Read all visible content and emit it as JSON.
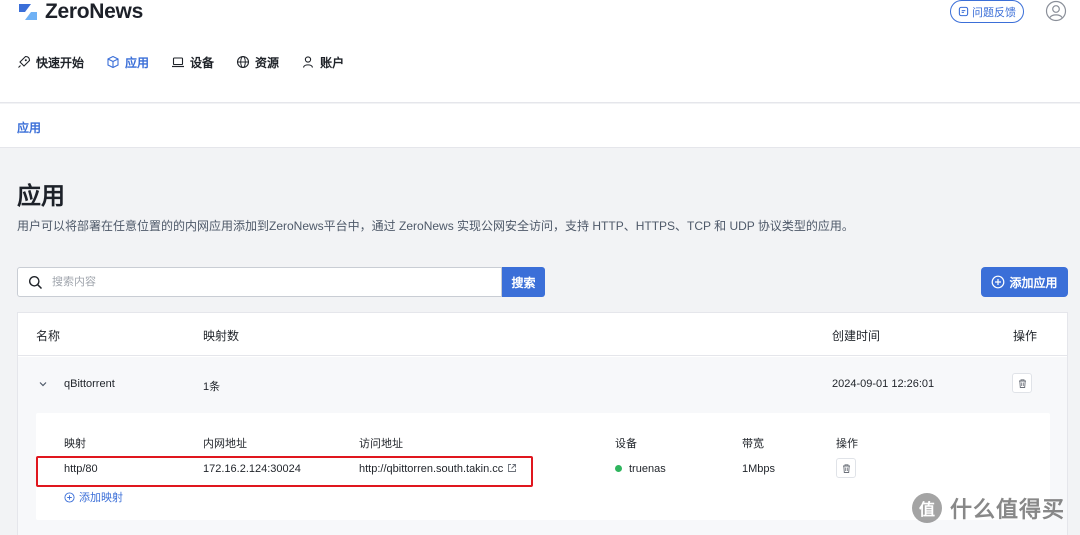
{
  "brand": {
    "name": "ZeroNews",
    "accent": "#3b6fd8"
  },
  "header": {
    "feedback_label": "问题反馈"
  },
  "nav": {
    "items": [
      {
        "label": "快速开始",
        "icon": "rocket-icon"
      },
      {
        "label": "应用",
        "icon": "cube-icon",
        "active": true
      },
      {
        "label": "设备",
        "icon": "laptop-icon"
      },
      {
        "label": "资源",
        "icon": "globe-icon"
      },
      {
        "label": "账户",
        "icon": "user-icon"
      }
    ]
  },
  "subnav": {
    "tab": "应用"
  },
  "page": {
    "title": "应用",
    "description": "用户可以将部署在任意位置的的内网应用添加到ZeroNews平台中，通过 ZeroNews 实现公网安全访问，支持 HTTP、HTTPS、TCP 和 UDP 协议类型的应用。"
  },
  "search": {
    "placeholder": "搜索内容",
    "value": "",
    "button_label": "搜索"
  },
  "add_app_label": "添加应用",
  "table": {
    "headers": {
      "name": "名称",
      "mappings": "映射数",
      "created": "创建时间",
      "actions": "操作"
    },
    "rows": [
      {
        "name": "qBittorrent",
        "mappings": "1条",
        "created": "2024-09-01 12:26:01"
      }
    ]
  },
  "mapping_table": {
    "headers": {
      "mapping": "映射",
      "internal": "内网地址",
      "access": "访问地址",
      "device": "设备",
      "bandwidth": "带宽",
      "actions": "操作"
    },
    "rows": [
      {
        "mapping": "http/80",
        "internal": "172.16.2.124:30024",
        "access": "http://qbittorren.south.takin.cc",
        "device": "truenas",
        "device_status_color": "#2fb55e",
        "bandwidth": "1Mbps"
      }
    ],
    "add_label": "添加映射"
  },
  "highlight_color": "#e0161e",
  "watermark": {
    "symbol": "值",
    "text": "什么值得买"
  }
}
